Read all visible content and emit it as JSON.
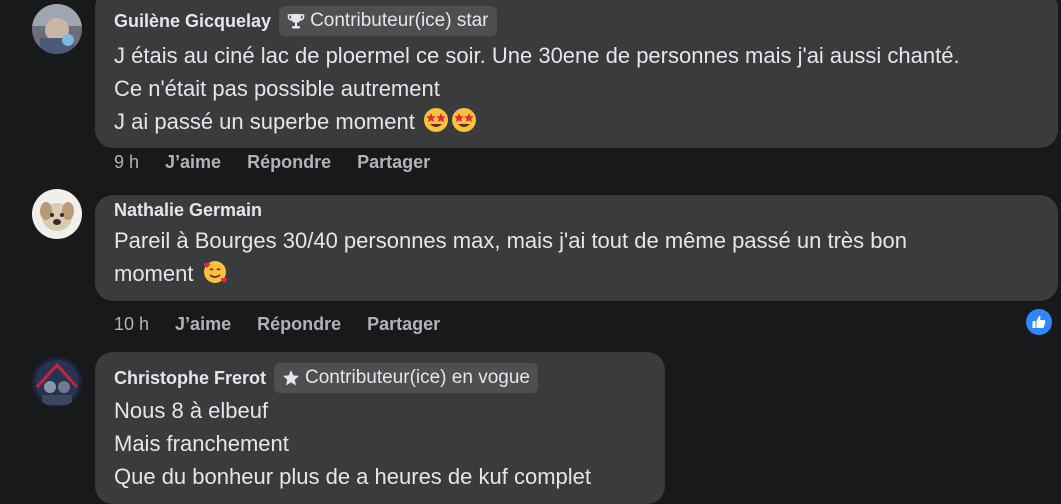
{
  "comments": [
    {
      "author": "Guilène Gicquelay",
      "badge": "Contributeur(ice) star",
      "badge_icon": "trophy-icon",
      "lines": [
        "J étais au ciné lac de ploermel ce soir. Une 30ene de personnes mais j'ai aussi chanté.",
        "Ce n'était pas possible autrement",
        "J ai passé un superbe moment"
      ],
      "emoji": [
        "star-struck-emoji",
        "star-struck-emoji"
      ],
      "time": "9 h",
      "like": "J’aime",
      "reply": "Répondre",
      "share": "Partager"
    },
    {
      "author": "Nathalie Germain",
      "lines": [
        "Pareil à Bourges 30/40 personnes max, mais j'ai tout de même passé un très bon",
        "moment"
      ],
      "emoji": [
        "smiling-face-with-hearts-emoji"
      ],
      "time": "10 h",
      "like": "J’aime",
      "reply": "Répondre",
      "share": "Partager",
      "reaction": "like-reaction-icon"
    },
    {
      "author": "Christophe Frerot",
      "badge": "Contributeur(ice) en vogue",
      "badge_icon": "star-icon",
      "lines": [
        "Nous 8 à elbeuf",
        "Mais franchement",
        "Que du bonheur plus de a heures de kuf complet"
      ]
    }
  ],
  "colors": {
    "background": "#18191a",
    "bubble": "#3a3b3c",
    "badge": "#4e4f50",
    "text": "#e4e6eb",
    "secondary_text": "#b0b3b8",
    "like_blue": "#2d88ff"
  }
}
